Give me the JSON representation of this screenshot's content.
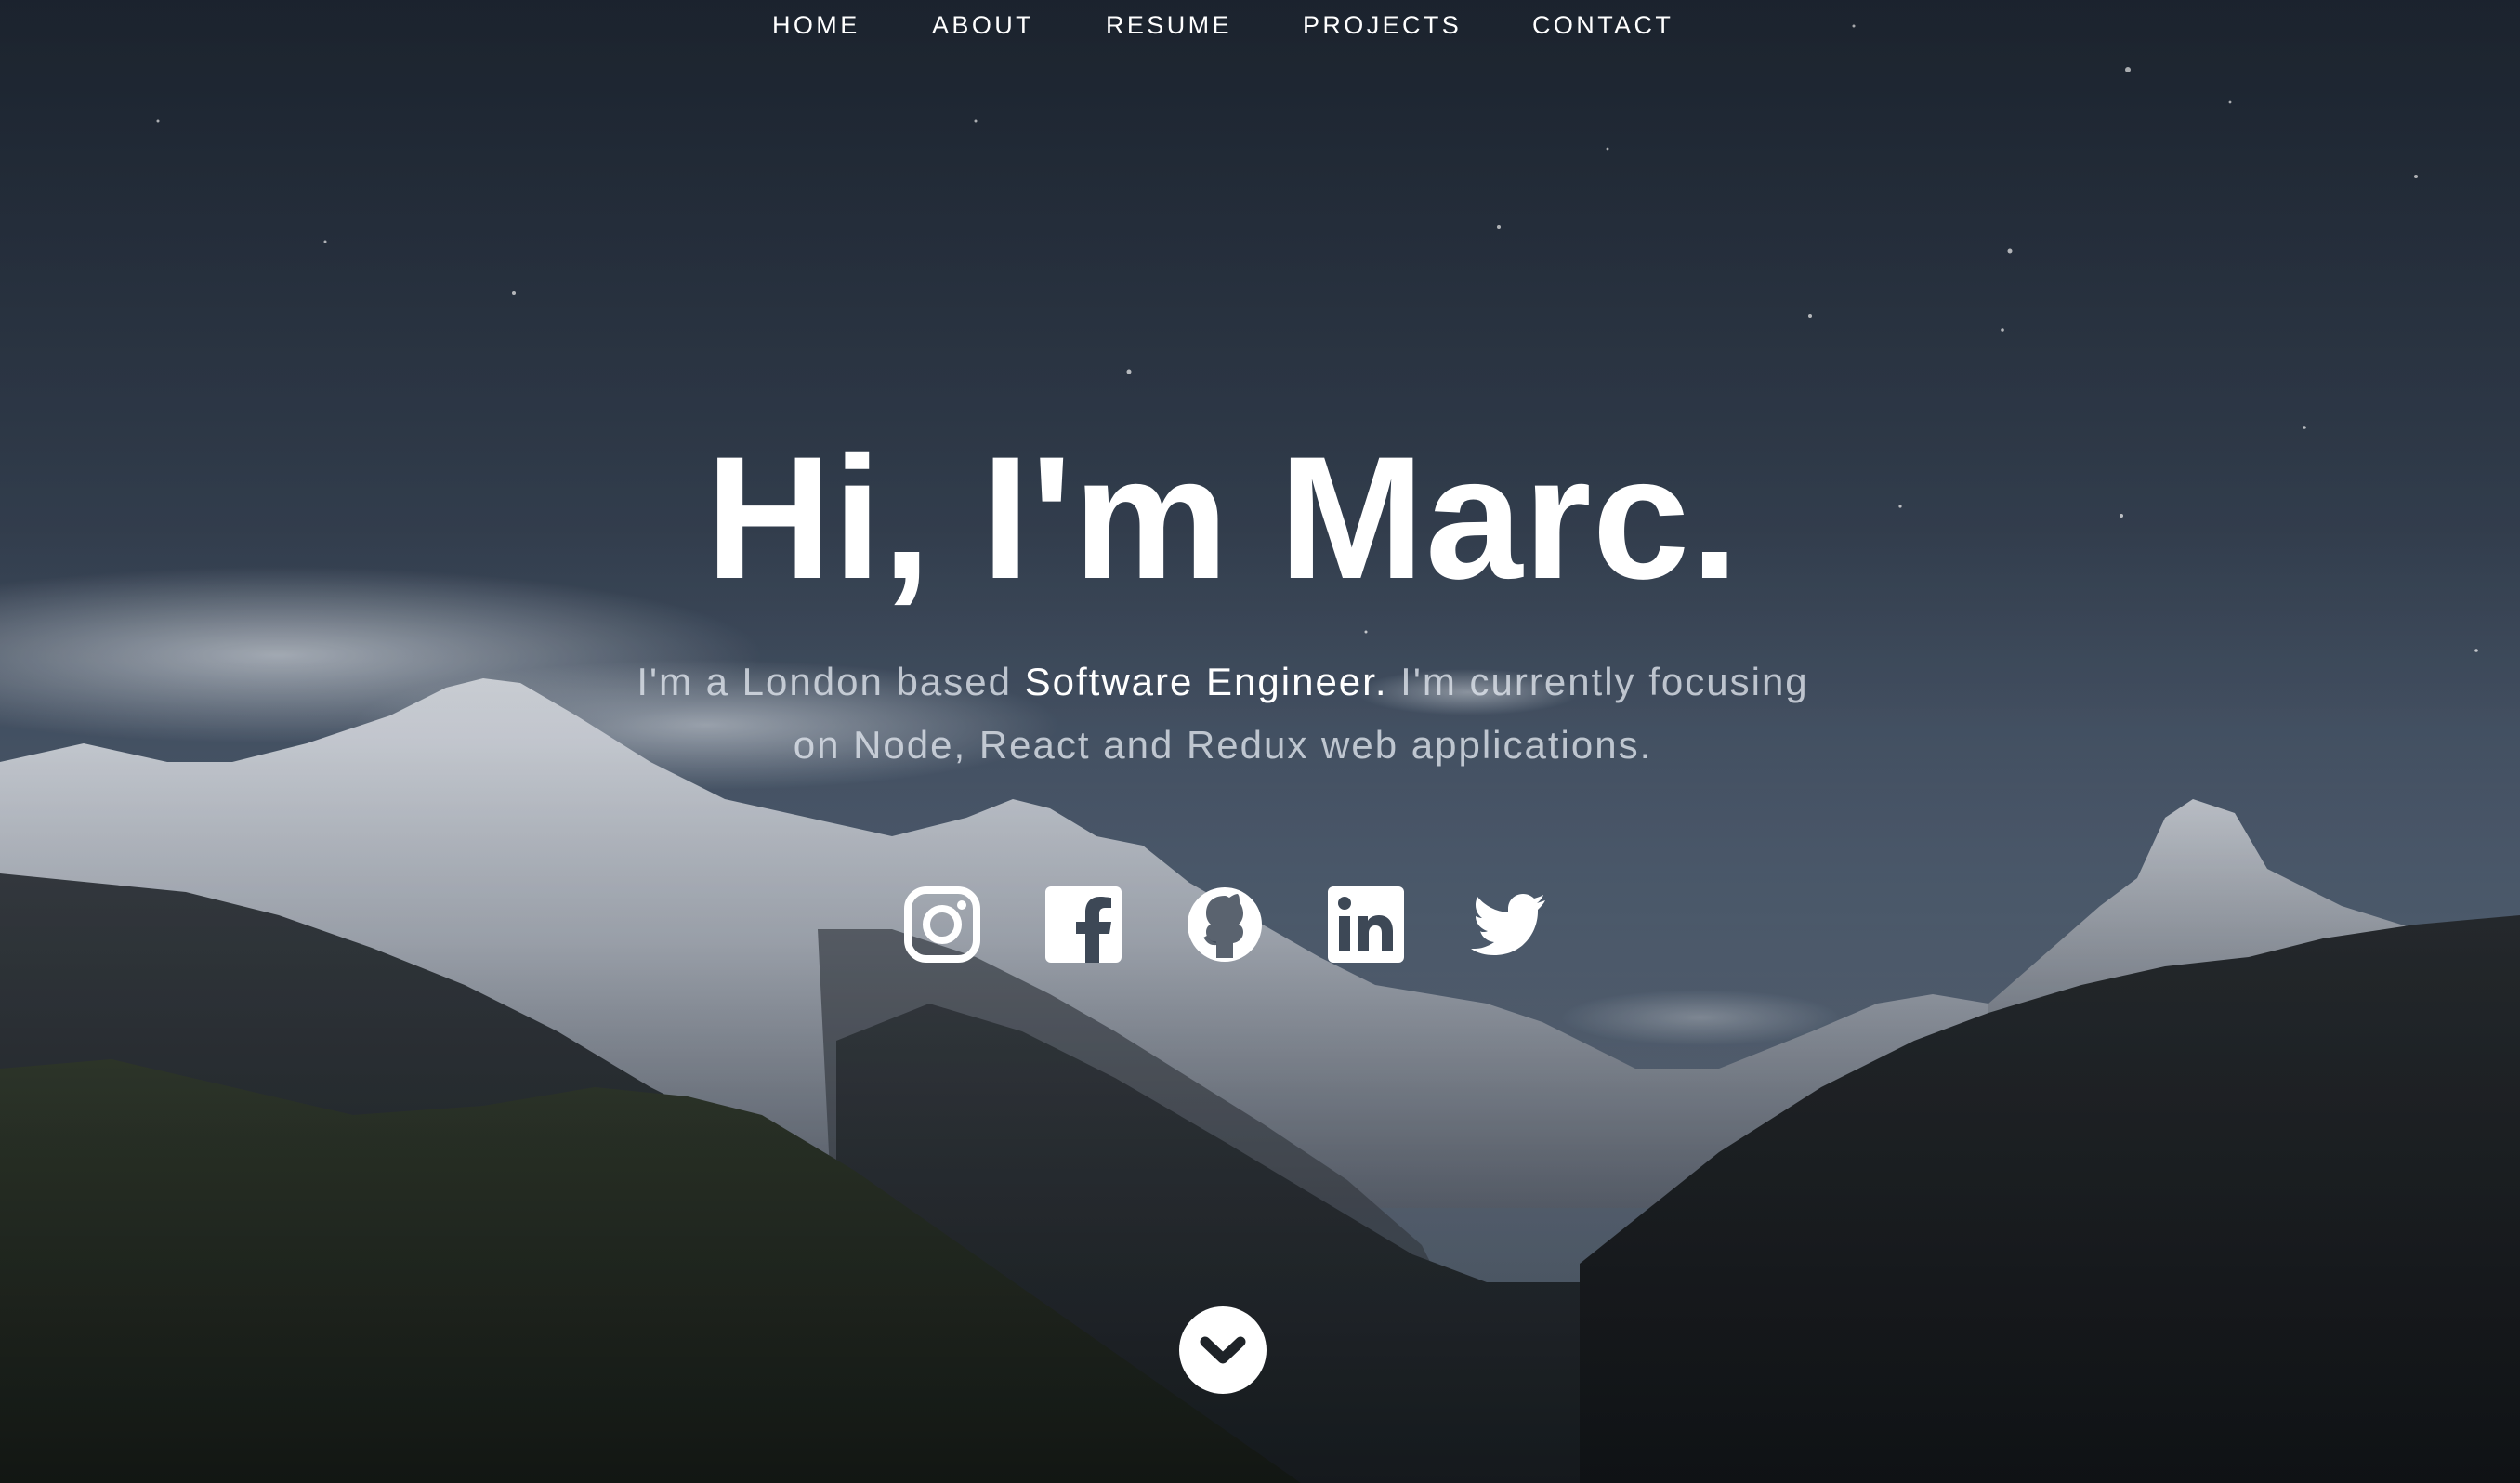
{
  "nav": {
    "items": [
      {
        "label": "HOME"
      },
      {
        "label": "ABOUT"
      },
      {
        "label": "RESUME"
      },
      {
        "label": "PROJECTS"
      },
      {
        "label": "CONTACT"
      }
    ]
  },
  "hero": {
    "headline": "Hi, I'm Marc.",
    "intro_before": "I'm a London based ",
    "intro_role": "Software Engineer.",
    "intro_after": " I'm currently focusing on Node, React and Redux web applications."
  },
  "social": [
    {
      "icon": "instagram-icon"
    },
    {
      "icon": "facebook-icon"
    },
    {
      "icon": "github-icon"
    },
    {
      "icon": "linkedin-icon"
    },
    {
      "icon": "twitter-icon"
    }
  ],
  "scroll": {
    "icon": "chevron-down-icon"
  },
  "colors": {
    "text": "#ffffff",
    "muted_text": "#e2e7ee",
    "sky_top": "#25303d",
    "sky_mid": "#4e5d70",
    "mountain_dark": "#1c1f21"
  }
}
